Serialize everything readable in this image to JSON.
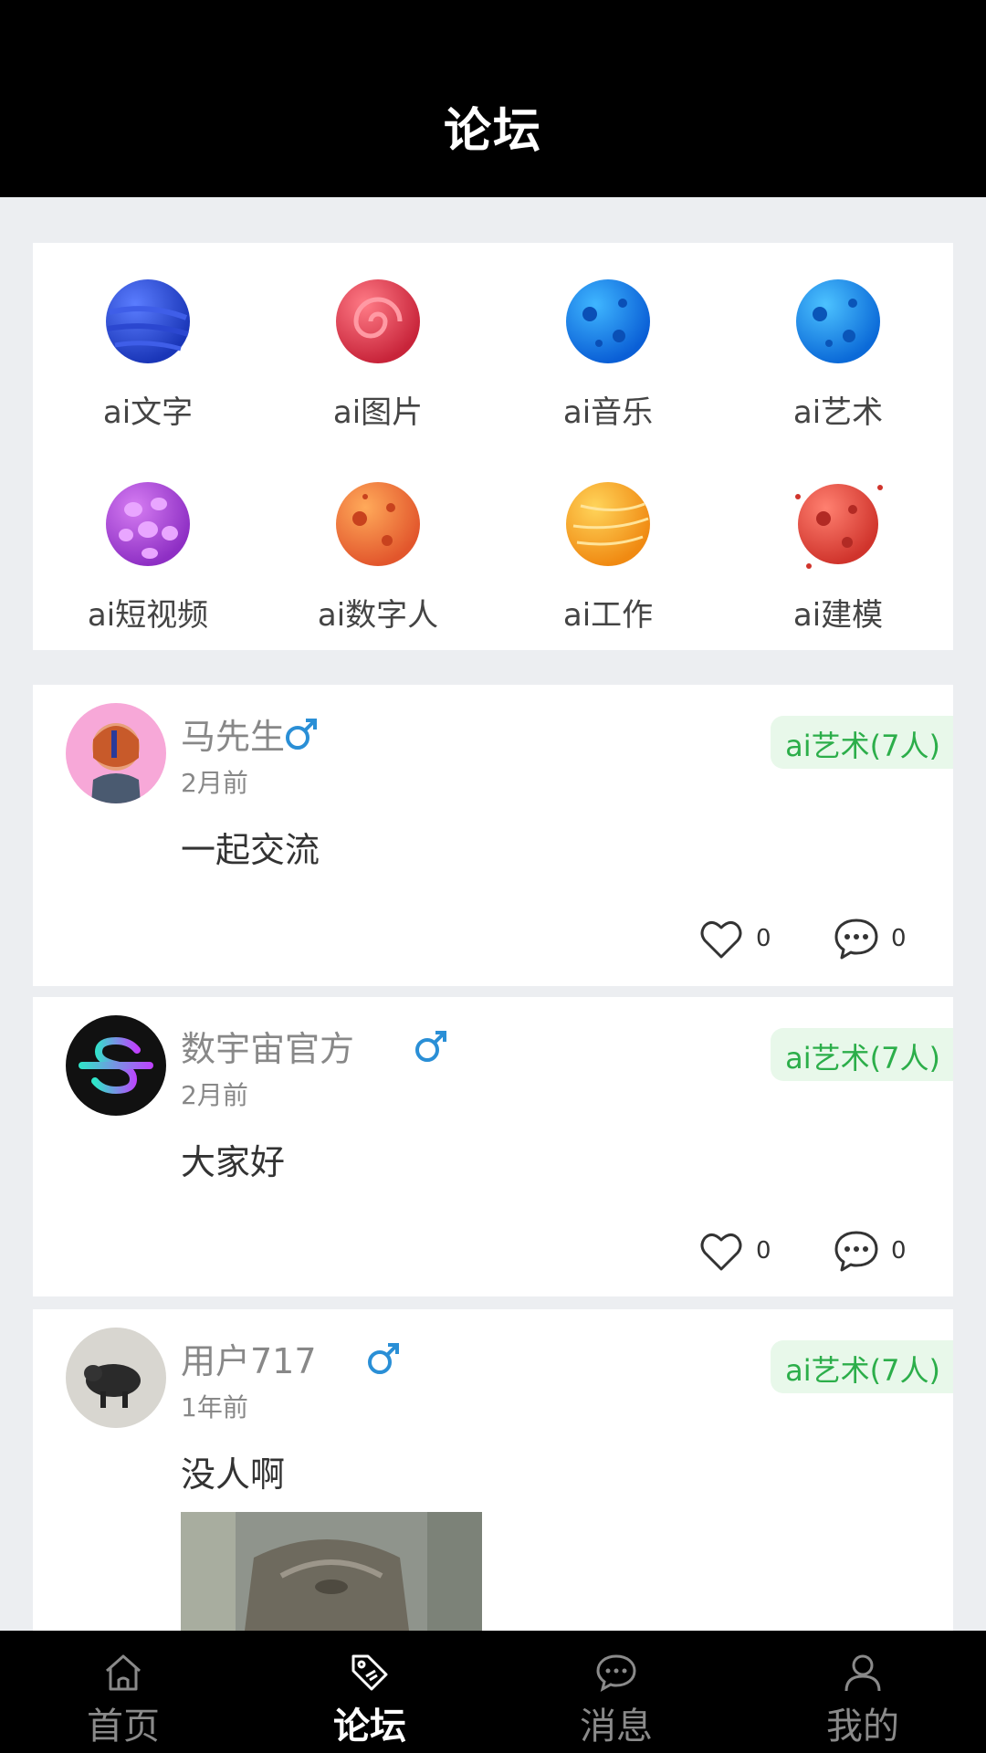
{
  "header": {
    "title": "论坛"
  },
  "categories": [
    {
      "label": "ai文字",
      "icon": "blue-planet-icon"
    },
    {
      "label": "ai图片",
      "icon": "red-swirl-planet-icon"
    },
    {
      "label": "ai音乐",
      "icon": "blue-moon-icon"
    },
    {
      "label": "ai艺术",
      "icon": "blue-moon-icon"
    },
    {
      "label": "ai短视频",
      "icon": "purple-planet-icon"
    },
    {
      "label": "ai数字人",
      "icon": "orange-moon-icon"
    },
    {
      "label": "ai工作",
      "icon": "yellow-planet-icon"
    },
    {
      "label": "ai建模",
      "icon": "red-moon-icon"
    }
  ],
  "posts": [
    {
      "user": "马先生",
      "time": "2月前",
      "tag": "ai艺术(7人)",
      "content": "一起交流",
      "likes": "0",
      "comments": "0"
    },
    {
      "user": "数宇宙官方",
      "time": "2月前",
      "tag": "ai艺术(7人)",
      "content": "大家好",
      "likes": "0",
      "comments": "0"
    },
    {
      "user": "用户717",
      "time": "1年前",
      "tag": "ai艺术(7人)",
      "content": "没人啊"
    }
  ],
  "tabbar": {
    "items": [
      {
        "label": "首页",
        "icon": "home-icon"
      },
      {
        "label": "论坛",
        "icon": "tag-icon"
      },
      {
        "label": "消息",
        "icon": "chat-bubble-icon"
      },
      {
        "label": "我的",
        "icon": "person-icon"
      }
    ]
  },
  "colors": {
    "accent_green": "#2cae4a",
    "tag_bg": "#e8f8ea",
    "gender_blue": "#2a8fd6"
  }
}
